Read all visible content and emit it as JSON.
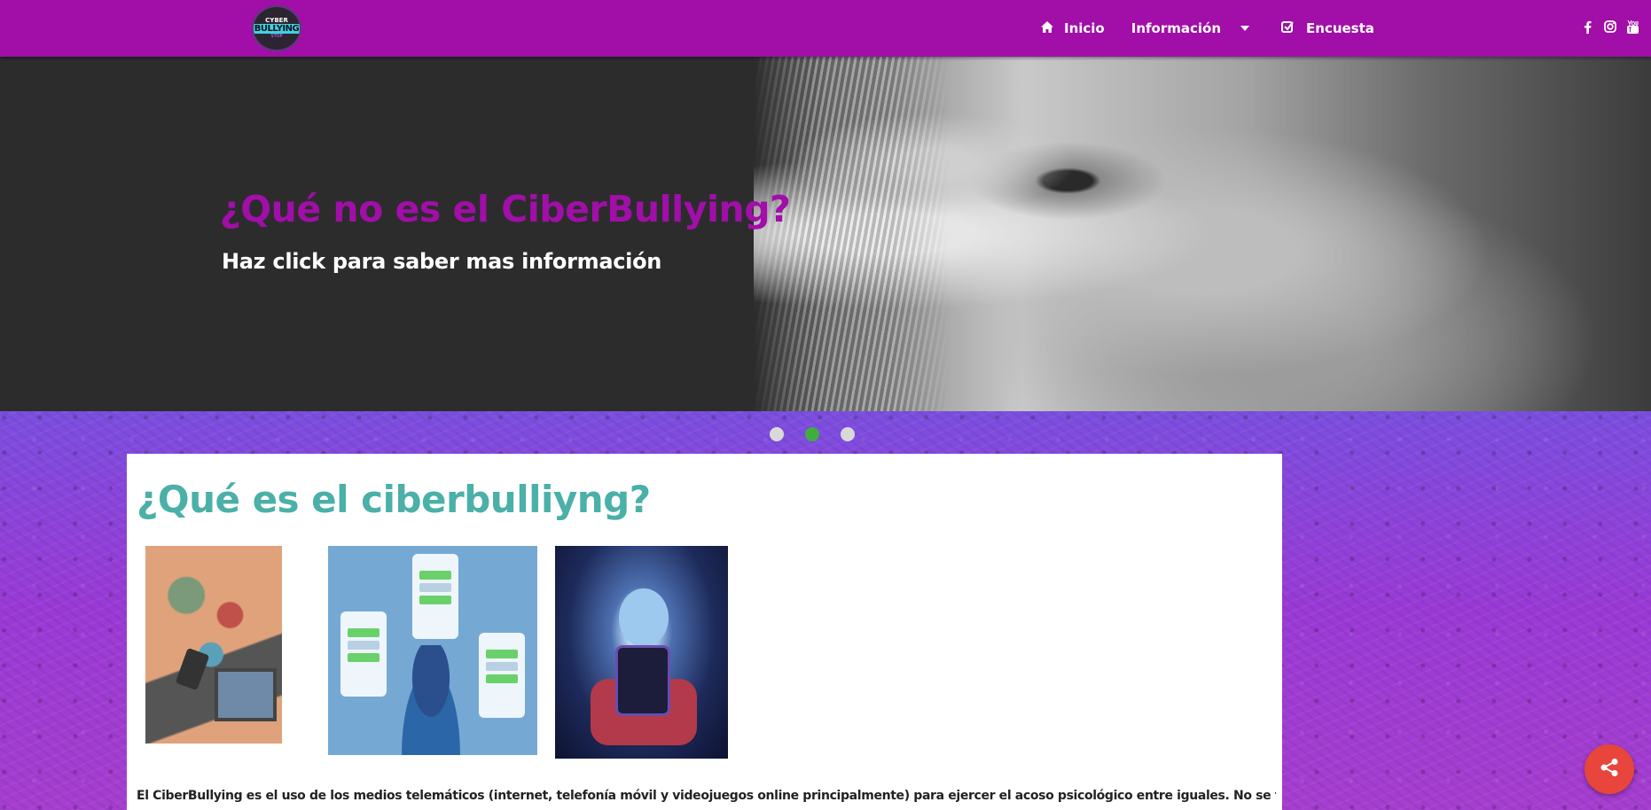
{
  "brand": {
    "logo_top": "CYBER",
    "logo_main": "BULLYING",
    "logo_sub": "STOP"
  },
  "nav": {
    "items": [
      {
        "label": "Inicio",
        "icon": "home-icon"
      },
      {
        "label": "Información",
        "icon": "",
        "dropdown": true
      },
      {
        "label": "Encuesta",
        "icon": "check-square-icon"
      }
    ],
    "social": [
      {
        "name": "facebook-icon",
        "glyph": "f"
      },
      {
        "name": "instagram-icon",
        "glyph": "◎"
      },
      {
        "name": "youtube-icon",
        "glyph": "▶"
      }
    ]
  },
  "hero": {
    "title": "¿Qué no es el CiberBullying?",
    "subtitle": "Haz click para saber mas información",
    "active_slide": 2,
    "slide_count": 3
  },
  "main": {
    "title": "¿Qué es el ciberbulliyng?",
    "paragraph": "El CiberBullying es el uso de los medios telemáticos (internet, telefonía móvil y videojuegos online principalmente) para ejercer el acoso psicológico entre iguales. No se trata aquí el"
  },
  "colors": {
    "navbar": "#a10ea8",
    "hero_title": "#a10ea8",
    "main_title": "#4ab0a8",
    "active_dot": "#3fae3f",
    "share_button": "#e8453c"
  },
  "fab": {
    "icon": "share-icon"
  }
}
